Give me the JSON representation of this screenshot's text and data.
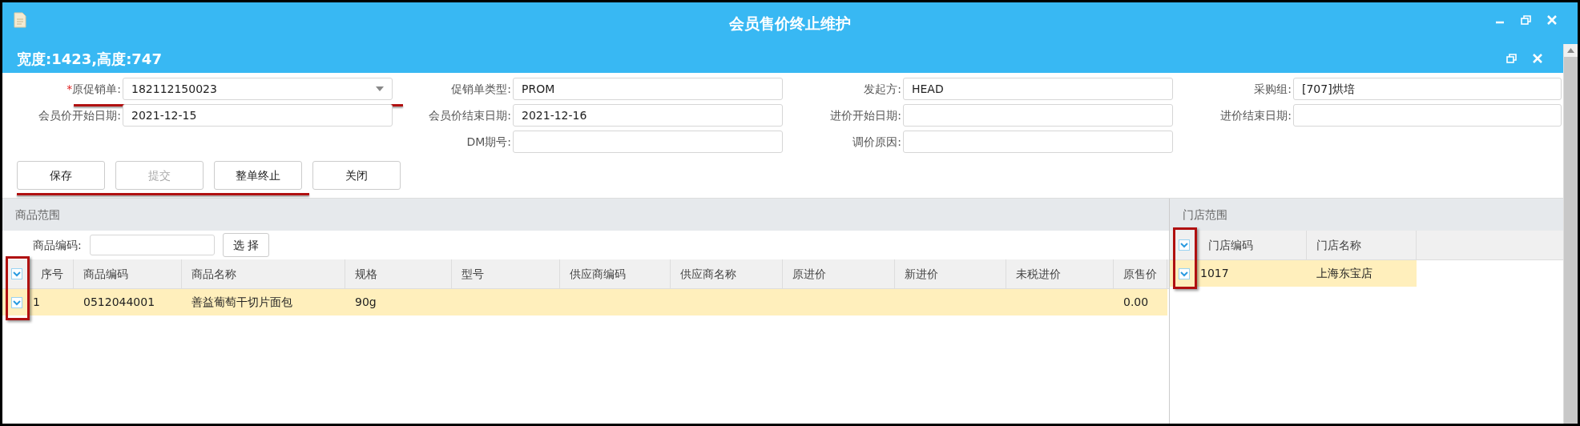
{
  "window": {
    "title": "会员售价终止维护",
    "subtitle": "宽度:1423,高度:747"
  },
  "form": {
    "highlighted_first_row_field": true,
    "fields": [
      {
        "required_mark": "*",
        "label": "原促销单:",
        "kind": "dropdown",
        "value": "182112150023"
      },
      {
        "label": "促销单类型:",
        "kind": "text",
        "value": "PROM"
      },
      {
        "label": "发起方:",
        "kind": "text",
        "value": "HEAD"
      },
      {
        "label": "采购组:",
        "kind": "text",
        "value": "[707]烘培"
      },
      {
        "label": "会员价开始日期:",
        "kind": "text",
        "value": "2021-12-15"
      },
      {
        "label": "会员价结束日期:",
        "kind": "text",
        "value": "2021-12-16"
      },
      {
        "label": "进价开始日期:",
        "kind": "text"
      },
      {
        "label": "进价结束日期:",
        "kind": "text"
      },
      {
        "label": "DM期号:",
        "kind": "text"
      },
      {
        "label": "调价原因:",
        "kind": "text"
      }
    ]
  },
  "toolbar": {
    "highlighted": true,
    "buttons": [
      {
        "label": "保存",
        "disabled": false
      },
      {
        "label": "提交",
        "disabled": true
      },
      {
        "label": "整单终止",
        "disabled": false
      },
      {
        "label": "关闭",
        "disabled": false
      }
    ]
  },
  "goods": {
    "title": "商品范围",
    "search_label": "商品编码:",
    "search_button": "选 择",
    "checkbox_column_highlighted": true,
    "header_checked": true,
    "columns": [
      "序号",
      "商品编码",
      "商品名称",
      "规格",
      "型号",
      "供应商编码",
      "供应商名称",
      "原进价",
      "新进价",
      "未税进价",
      "原售价"
    ],
    "rows": [
      {
        "checked": true,
        "selected": true,
        "cells": [
          "1",
          "0512044001",
          "善益葡萄干切片面包",
          "90g",
          "",
          "",
          "",
          "",
          "",
          "",
          "0.00"
        ]
      }
    ]
  },
  "stores": {
    "title": "门店范围",
    "checkbox_column_highlighted": true,
    "header_checked": true,
    "columns": [
      "门店编码",
      "门店名称"
    ],
    "rows": [
      {
        "checked": true,
        "selected": true,
        "cells": [
          "1017",
          "上海东宝店"
        ]
      }
    ]
  }
}
